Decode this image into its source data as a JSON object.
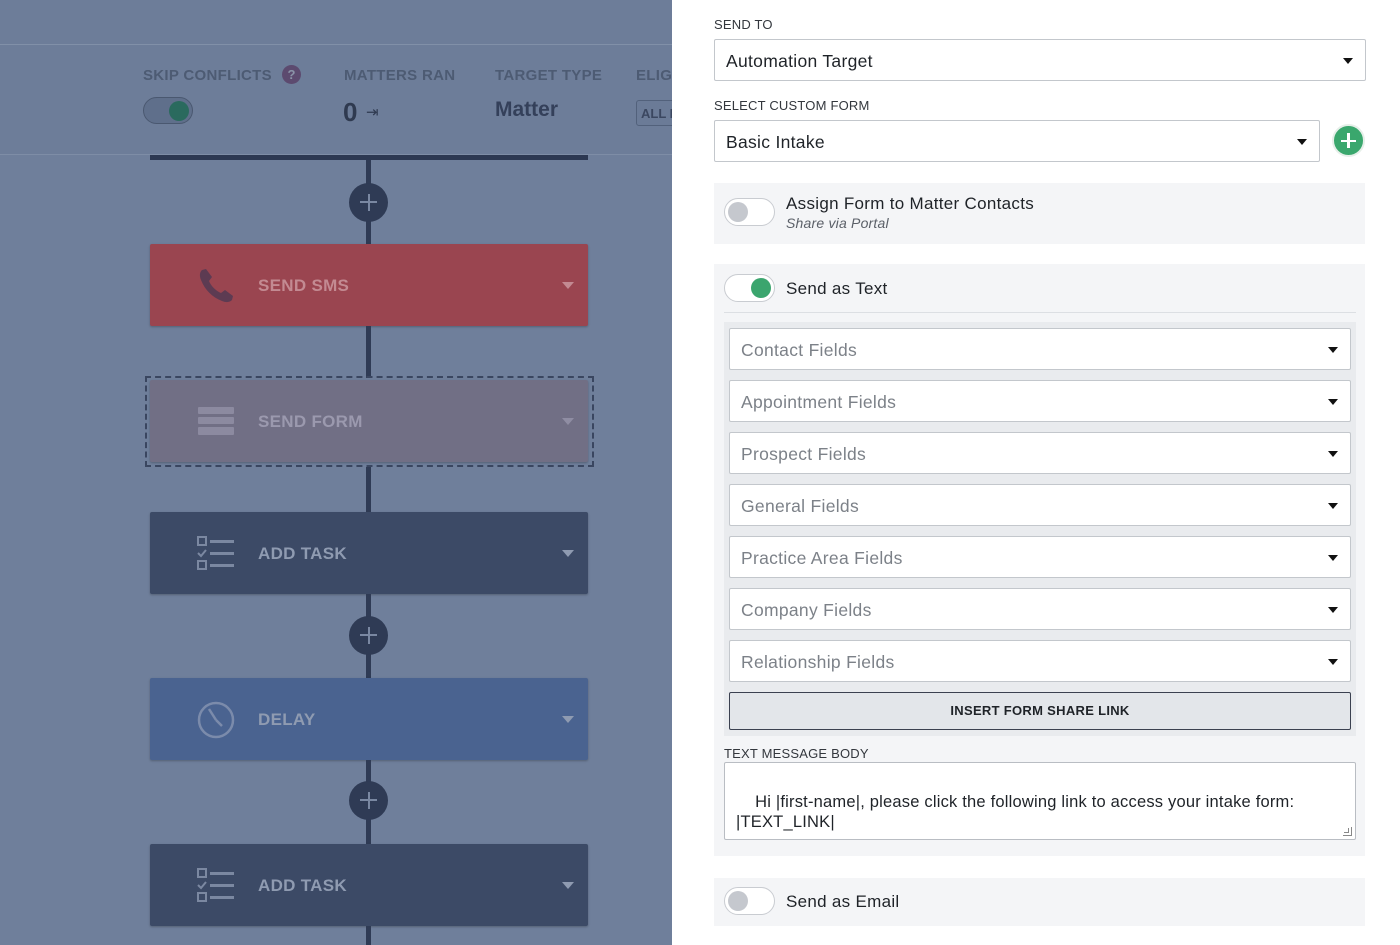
{
  "stats": {
    "skip_conflicts_label": "SKIP CONFLICTS",
    "help_glyph": "?",
    "matters_ran_label": "MATTERS RAN",
    "matters_ran_value": "0",
    "matters_ran_icon": "⇥",
    "target_type_label": "TARGET TYPE",
    "target_type_value": "Matter",
    "eligibility_label": "ELIGI",
    "eligibility_button": "ALL F",
    "skip_conflicts_on": true
  },
  "workflow": {
    "steps": [
      {
        "label": "SEND SMS",
        "icon": "phone-icon"
      },
      {
        "label": "SEND FORM",
        "icon": "form-icon"
      },
      {
        "label": "ADD TASK",
        "icon": "checklist-icon"
      },
      {
        "label": "DELAY",
        "icon": "clock-icon"
      },
      {
        "label": "ADD TASK",
        "icon": "checklist-icon"
      }
    ]
  },
  "panel": {
    "send_to_label": "SEND TO",
    "send_to_value": "Automation Target",
    "custom_form_label": "SELECT CUSTOM FORM",
    "custom_form_value": "Basic Intake",
    "assign_title": "Assign Form to Matter Contacts",
    "assign_sub": "Share via Portal",
    "assign_on": false,
    "send_text_title": "Send as Text",
    "send_text_on": true,
    "field_selects": [
      "Contact Fields",
      "Appointment Fields",
      "Prospect Fields",
      "General Fields",
      "Practice Area Fields",
      "Company Fields",
      "Relationship Fields"
    ],
    "insert_link_label": "INSERT FORM SHARE LINK",
    "message_body_label": "TEXT MESSAGE BODY",
    "message_body": "Hi |first-name|, please click the following link to access your intake form:\n|TEXT_LINK|",
    "send_email_title": "Send as Email",
    "send_email_on": false
  },
  "colors": {
    "accent_green": "#3ba56e",
    "sms_red": "#9a4550",
    "delay_blue": "#4a6390"
  }
}
